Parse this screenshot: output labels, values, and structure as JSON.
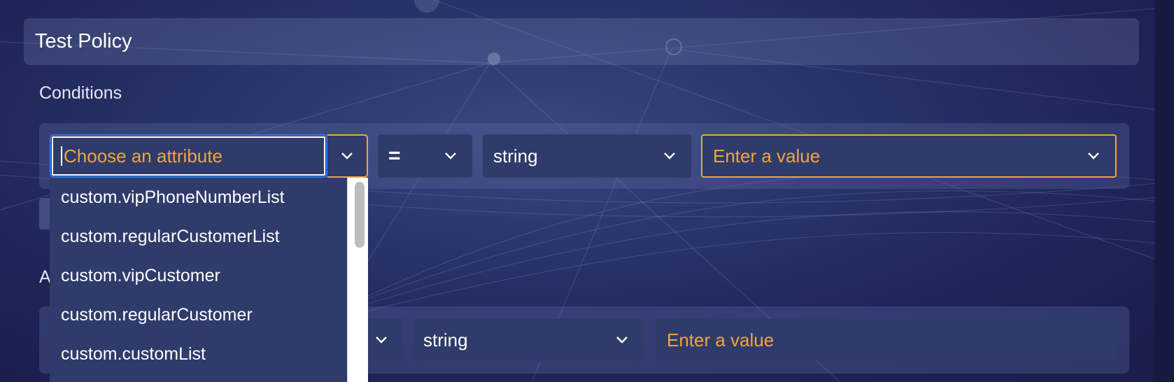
{
  "policy": {
    "title": "Test Policy"
  },
  "conditions": {
    "label": "Conditions",
    "row": {
      "attribute_placeholder": "Choose an attribute",
      "operator": "=",
      "type": "string",
      "value_placeholder": "Enter a value"
    },
    "dropdown_options": [
      "custom.vipPhoneNumberList",
      "custom.regularCustomerList",
      "custom.vipCustomer",
      "custom.regularCustomer",
      "custom.customList"
    ]
  },
  "actions": {
    "label_visible": "A",
    "row": {
      "type": "string",
      "value_placeholder": "Enter a value"
    }
  },
  "colors": {
    "accent_orange": "#f0a63a",
    "focus_blue": "#2f7ae8",
    "control_bg": "#2f3b6a"
  }
}
